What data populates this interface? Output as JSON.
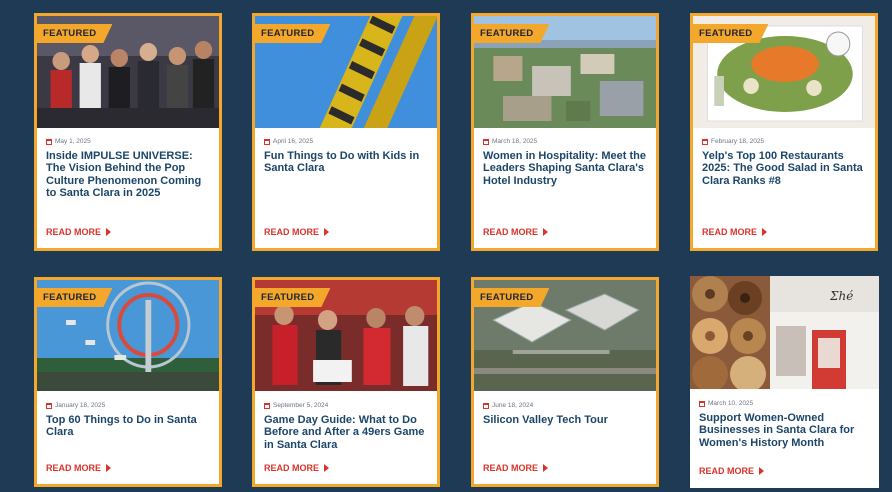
{
  "badge_label": "FEATURED",
  "cards": [
    {
      "date": "May 1, 2025",
      "title": "Inside IMPULSE UNIVERSE: The Vision Behind the Pop Culture Phenomenon Coming to Santa Clara in 2025",
      "more": "READ MORE",
      "featured": true
    },
    {
      "date": "April 16, 2025",
      "title": "Fun Things to Do with Kids in Santa Clara",
      "more": "READ MORE",
      "featured": true
    },
    {
      "date": "March 18, 2025",
      "title": "Women in Hospitality: Meet the Leaders Shaping Santa Clara's Hotel Industry",
      "more": "READ MORE",
      "featured": true
    },
    {
      "date": "February 18, 2025",
      "title": "Yelp's Top 100 Restaurants 2025: The Good Salad in Santa Clara Ranks #8",
      "more": "READ MORE",
      "featured": true
    },
    {
      "date": "January 18, 2025",
      "title": "Top 60 Things to Do in Santa Clara",
      "more": "READ MORE",
      "featured": true
    },
    {
      "date": "September 5, 2024",
      "title": "Game Day Guide: What to Do Before and After a 49ers Game in Santa Clara",
      "more": "READ MORE",
      "featured": true
    },
    {
      "date": "June 18, 2024",
      "title": "Silicon Valley Tech Tour",
      "more": "READ MORE",
      "featured": true
    },
    {
      "date": "March 10, 2025",
      "title": "Support Women-Owned Businesses in Santa Clara for Women's History Month",
      "more": "READ MORE",
      "featured": false
    }
  ],
  "colors": {
    "background": "#1f3a55",
    "accent": "#f3a72b",
    "title": "#1c4669",
    "link": "#d9342b"
  }
}
